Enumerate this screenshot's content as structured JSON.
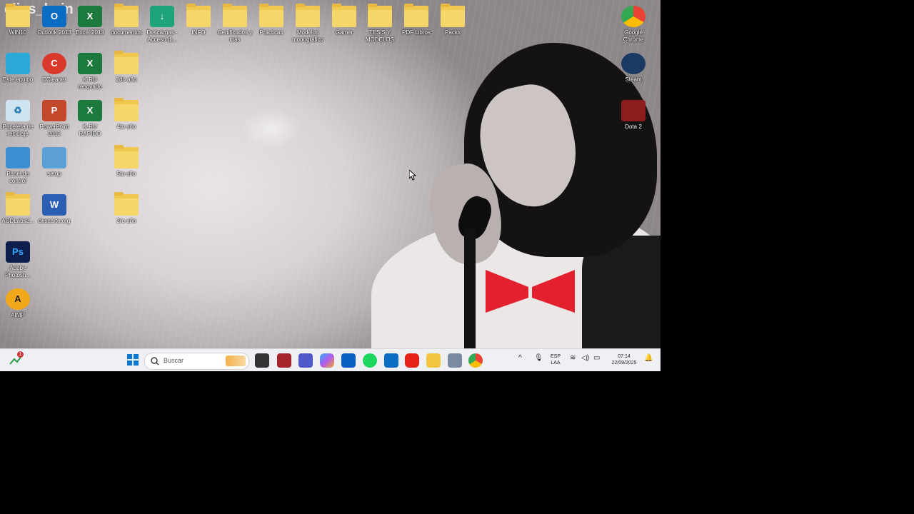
{
  "overlay_title": "elias_bain",
  "desktop": {
    "icons": [
      {
        "label": "WIN10"
      },
      {
        "label": "Outlook 2013"
      },
      {
        "label": "Excel 2013"
      },
      {
        "label": "documentos"
      },
      {
        "label": "Descargas - Acceso di..."
      },
      {
        "label": "INFO"
      },
      {
        "label": "Certificados y más"
      },
      {
        "label": "Prácticas"
      },
      {
        "label": "Modelos monográfico"
      },
      {
        "label": "Gamer"
      },
      {
        "label": "TESIS Y MODELOS"
      },
      {
        "label": "PDF Libros"
      },
      {
        "label": "Packs"
      },
      {
        "label": "Este equipo"
      },
      {
        "label": "CCleaner"
      },
      {
        "label": "K-RU renovado"
      },
      {
        "label": "2do año"
      },
      {
        "label": "Papelera de reciclaje"
      },
      {
        "label": "PowerPoint 2013"
      },
      {
        "label": "K-RU RÁPIDO"
      },
      {
        "label": "4to año"
      },
      {
        "label": "Panel de control"
      },
      {
        "label": "setup"
      },
      {
        "label": "5to año"
      },
      {
        "label": "ACDLabs2..."
      },
      {
        "label": "descarte.org"
      },
      {
        "label": "3ro año"
      },
      {
        "label": "Adobe Photosh..."
      },
      {
        "label": "AIMP"
      },
      {
        "label": "Google Chrome"
      },
      {
        "label": "Steam"
      },
      {
        "label": "Dota 2"
      }
    ]
  },
  "taskbar": {
    "search_placeholder": "Buscar",
    "language": "ESP",
    "layout": "LAA",
    "time": "07:14",
    "date": "22/09/2025",
    "notification_badge": "1"
  },
  "colors": {
    "taskbar_bg": "#eef0f3",
    "folder": "#f5d66a",
    "bowtie": "#e2202e"
  }
}
